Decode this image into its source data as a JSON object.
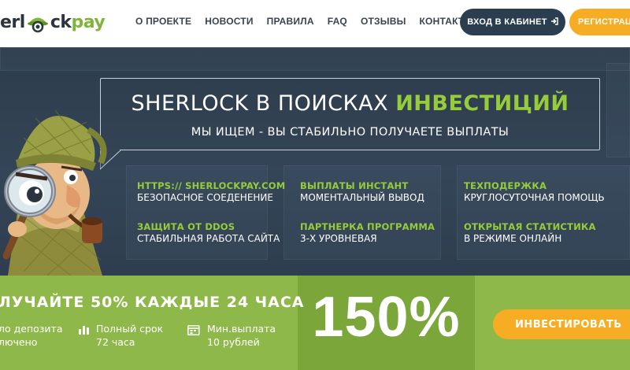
{
  "header": {
    "logo": {
      "part1": "erl",
      "part2": "ck",
      "part3": "pay"
    },
    "nav": [
      {
        "label": "О ПРОЕКТЕ"
      },
      {
        "label": "НОВОСТИ"
      },
      {
        "label": "ПРАВИЛА"
      },
      {
        "label": "FAQ"
      },
      {
        "label": "ОТЗЫВЫ"
      },
      {
        "label": "КОНТАКТЫ"
      }
    ],
    "login_label": "ВХОД В КАБИНЕТ",
    "login_icon": "sign-in-icon",
    "register_label": "РЕГИСТРАЦИ"
  },
  "hero": {
    "title_main": "SHERLOCK В ПОИСКАХ ",
    "title_accent": "ИНВЕСТИЦИЙ",
    "subtitle": "МЫ ИЩЕМ - ВЫ СТАБИЛЬНО ПОЛУЧАЕТЕ ВЫПЛАТЫ",
    "features": [
      {
        "title": "HTTPS:// SHERLOCKPAY.COM",
        "desc": "БЕЗОПАСНОЕ СОЕДЕНЕНИЕ"
      },
      {
        "title": "ВЫПЛАТЫ ИНСТАНТ",
        "desc": "МОМЕНТАЛЬНЫЙ ВЫВОД"
      },
      {
        "title": "ТЕХПОДЕРЖКА",
        "desc": "КРУГЛОСУТОЧНАЯ ПОМОЩЬ"
      },
      {
        "title": "ЗАЩИТА ОТ DDOS",
        "desc": "СТАБИЛЬНАЯ РАБОТА САЙТА"
      },
      {
        "title": "ПАРТНЕРКА ПРОГРАММА",
        "desc": "3-Х УРОВНЕВАЯ"
      },
      {
        "title": "ОТКРЫТАЯ СТАТИСТИКА",
        "desc": "В РЕЖИМЕ ОНЛАЙН"
      }
    ]
  },
  "offer": {
    "headline": "ЛУЧАЙТЕ 50% КАЖДЫЕ 24 ЧАСА",
    "perks": [
      {
        "line1": "ло депозита",
        "line2": "лючено"
      },
      {
        "line1": "Полный срок",
        "line2": "72 часа",
        "icon": "bar-chart-icon"
      },
      {
        "line1": "Мин.выплата",
        "line2": "10 рублей",
        "icon": "calendar-icon"
      }
    ],
    "percent": "150%",
    "invest_label": "ИНВЕСТИРОВАТЬ"
  },
  "colors": {
    "accent_green": "#96cc3c",
    "band_green": "#8fb84a",
    "orange": "#f6ad24",
    "navy": "#2b3e50",
    "hero_bg": "#344557"
  }
}
